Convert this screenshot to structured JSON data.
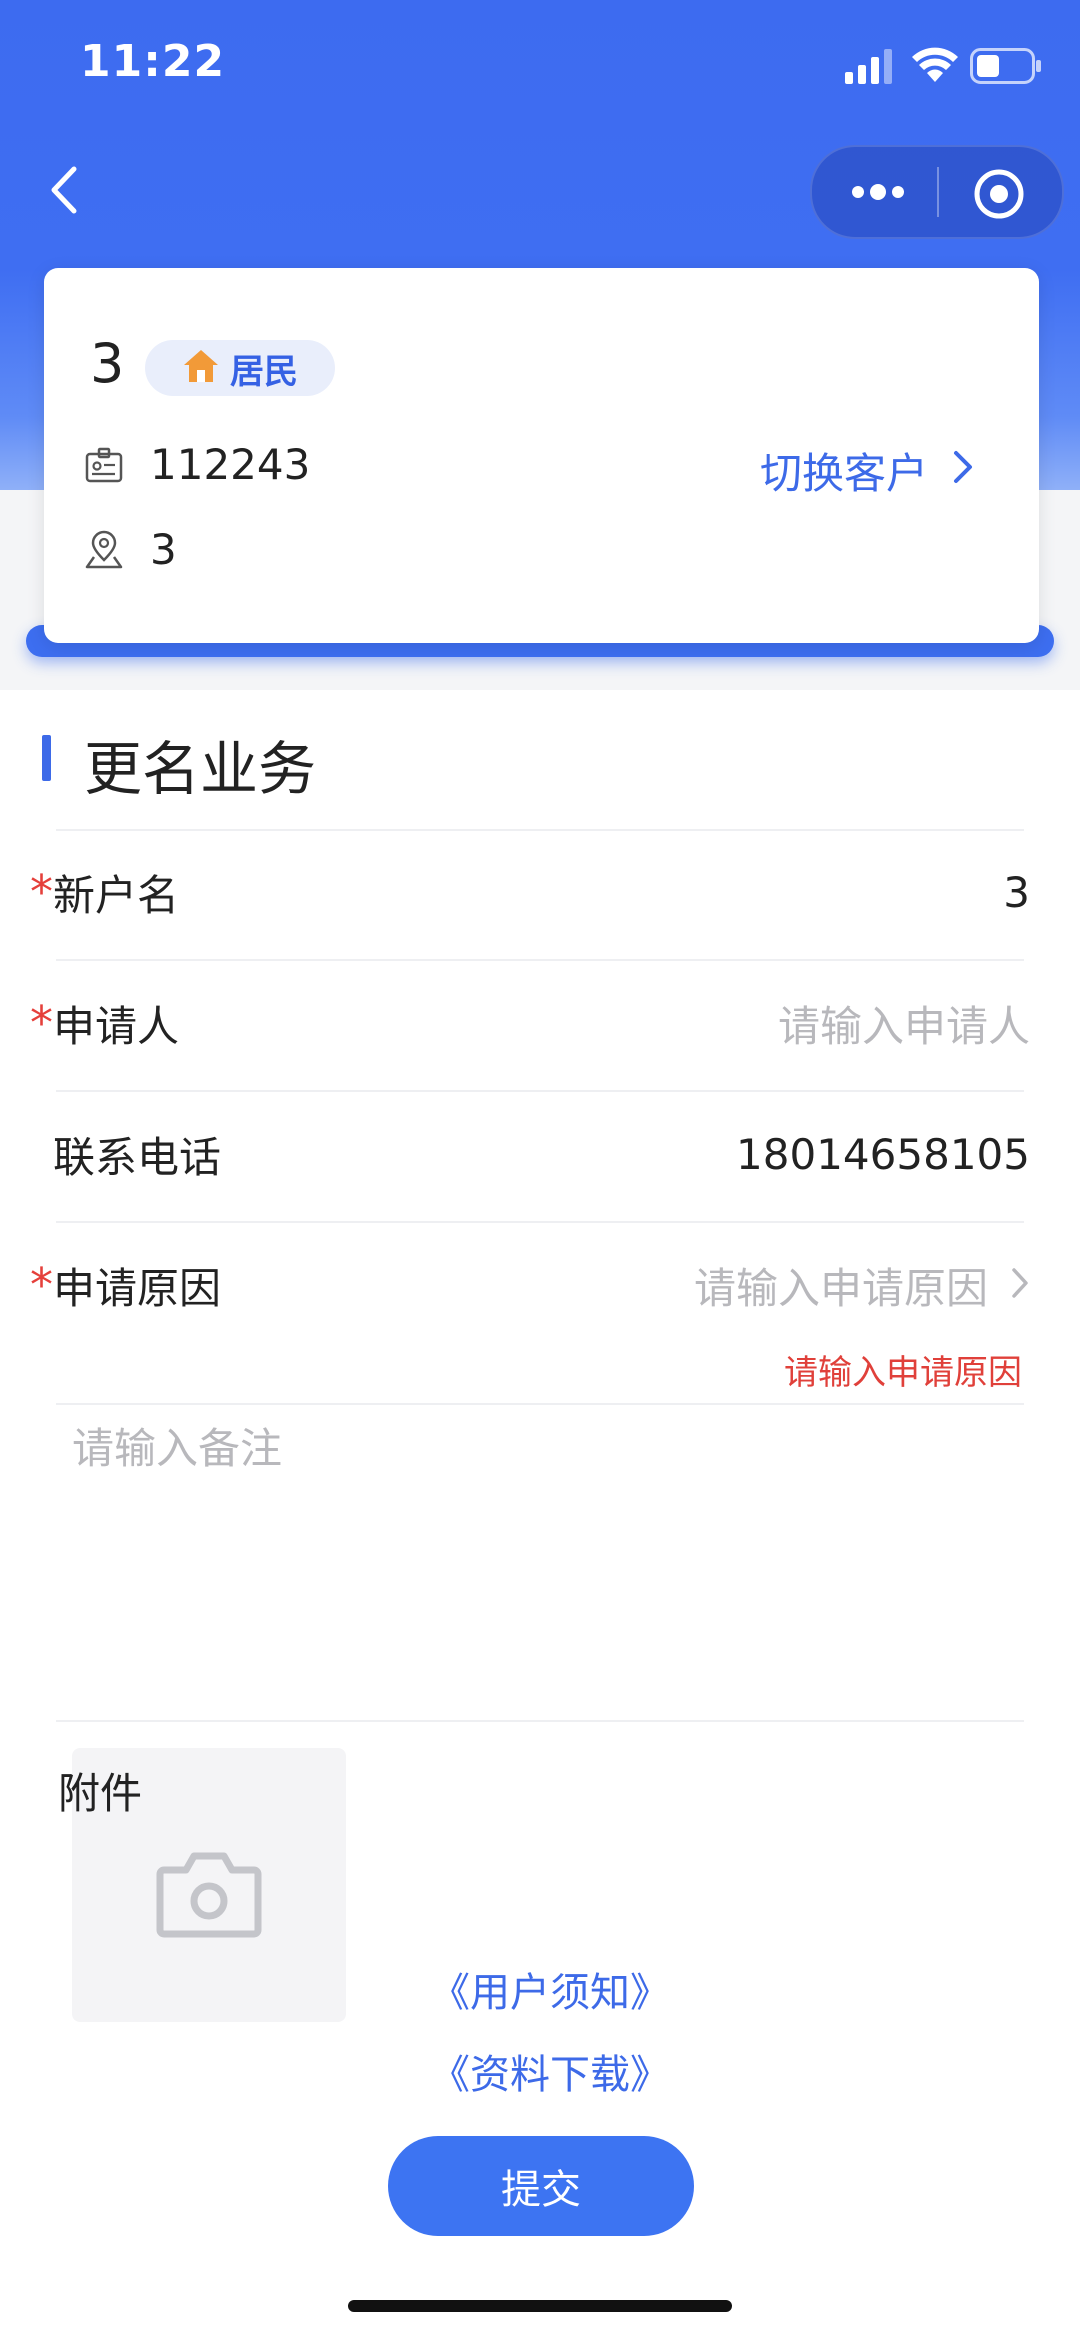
{
  "status_bar": {
    "time": "11:22"
  },
  "customer_card": {
    "name": "3",
    "type_tag": "居民",
    "account_id": "112243",
    "address": "3",
    "switch_label": "切换客户"
  },
  "section": {
    "title": "更名业务"
  },
  "form": {
    "new_name": {
      "label": "新户名",
      "value": "3"
    },
    "applicant": {
      "label": "申请人",
      "placeholder": "请输入申请人"
    },
    "phone": {
      "label": "联系电话",
      "value": "18014658105"
    },
    "reason": {
      "label": "申请原因",
      "placeholder": "请输入申请原因",
      "error": "请输入申请原因"
    },
    "remark": {
      "placeholder": "请输入备注"
    },
    "attachment": {
      "label": "附件"
    }
  },
  "links": {
    "user_notice": "《用户须知》",
    "material_download": "《资料下载》"
  },
  "submit": {
    "label": "提交"
  },
  "colors": {
    "primary": "#3d6ae8",
    "error": "#e5403b"
  }
}
